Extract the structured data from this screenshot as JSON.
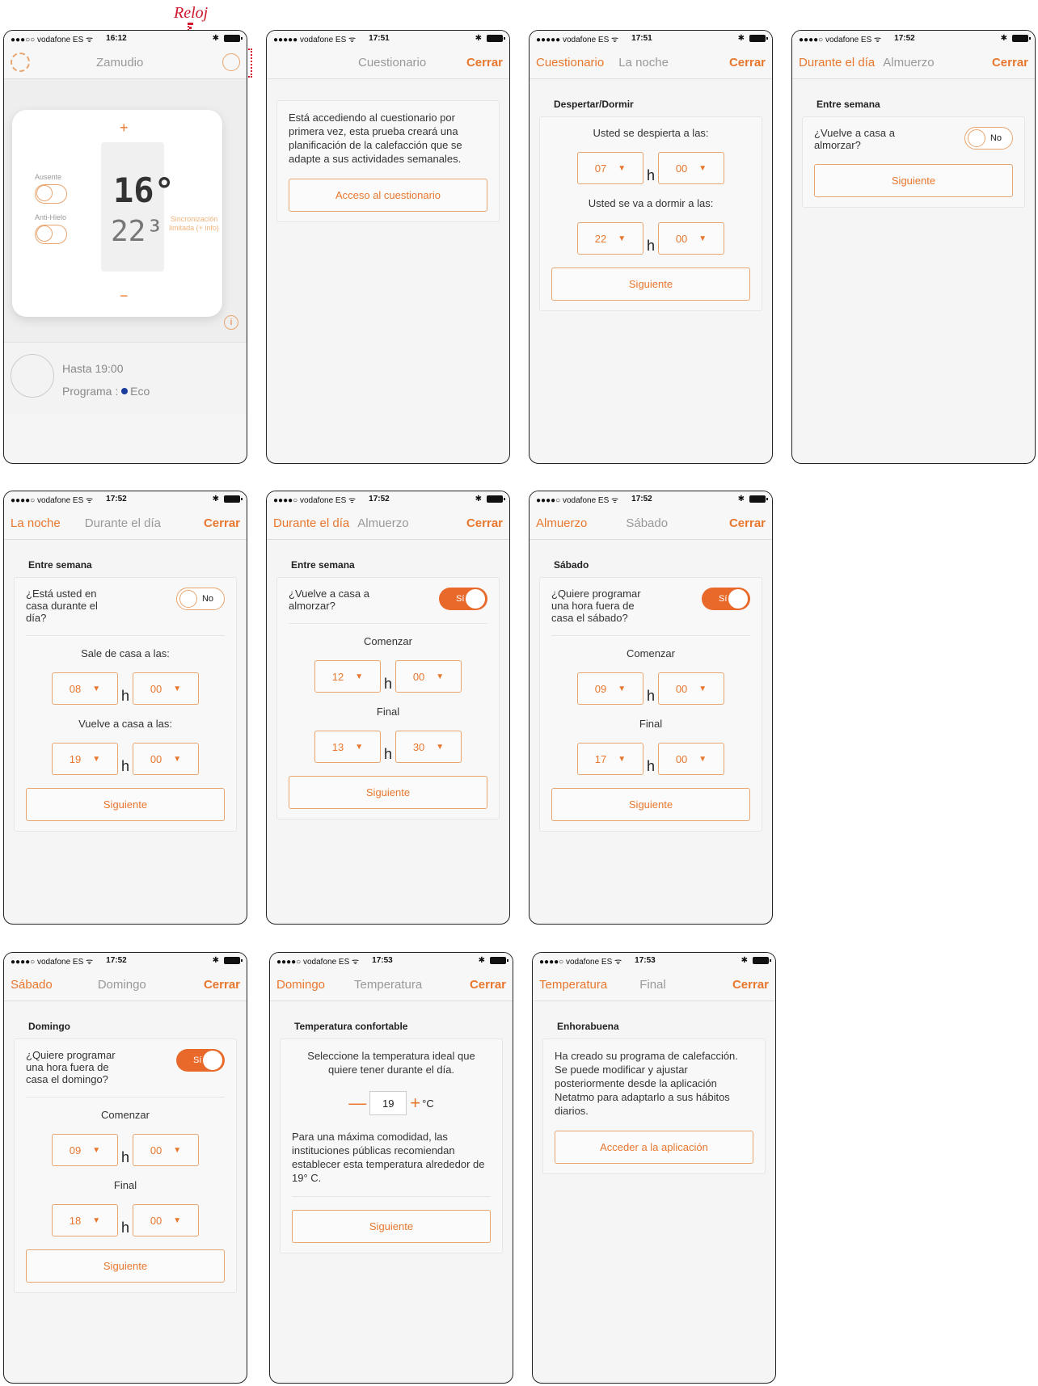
{
  "callout": {
    "label": "Reloj"
  },
  "screens": {
    "s1": {
      "status": {
        "carrier": "●●●○○ vodafone ES ᯤ",
        "time": "16:12"
      },
      "nav_title": "Zamudio",
      "thermostat": {
        "plus": "+",
        "minus": "−",
        "temp_current": "16°",
        "temp_setpoint": "22³",
        "absent_label": "Ausente",
        "antifreeze_label": "Anti-Hielo",
        "sync_text": "Sincronización limitada (+ info)",
        "info": "i"
      },
      "footer": {
        "until": "Hasta 19:00",
        "program_prefix": "Programa :",
        "program_value": "Eco"
      }
    },
    "s2": {
      "status": {
        "carrier": "●●●●● vodafone ES ᯤ",
        "time": "17:51"
      },
      "nav": {
        "title": "Cuestionario",
        "close": "Cerrar"
      },
      "card_text": "Está accediendo al cuestionario por primera vez, esta prueba creará una planificación de la calefacción que se adapte a sus actividades semanales.",
      "button": "Acceso al cuestionario"
    },
    "s3": {
      "status": {
        "carrier": "●●●●● vodafone ES ᯤ",
        "time": "17:51"
      },
      "nav": {
        "prev": "Cuestionario",
        "title": "La noche",
        "close": "Cerrar"
      },
      "section": "Despertar/Dormir",
      "wake_label": "Usted se despierta a las:",
      "wake": {
        "h": "07",
        "m": "00"
      },
      "sleep_label": "Usted se va a dormir a las:",
      "sleep": {
        "h": "22",
        "m": "00"
      },
      "h": "h",
      "button": "Siguiente"
    },
    "s4": {
      "status": {
        "carrier": "●●●●○ vodafone ES ᯤ",
        "time": "17:52"
      },
      "nav": {
        "prev": "Durante el día",
        "title": "Almuerzo",
        "close": "Cerrar"
      },
      "section": "Entre semana",
      "question": "¿Vuelve a casa a almorzar?",
      "toggle": "No",
      "button": "Siguiente"
    },
    "s5": {
      "status": {
        "carrier": "●●●●○ vodafone ES ᯤ",
        "time": "17:52"
      },
      "nav": {
        "prev": "La noche",
        "title": "Durante el día",
        "close": "Cerrar"
      },
      "section": "Entre semana",
      "question": "¿Está usted en casa durante el día?",
      "toggle": "No",
      "leave_label": "Sale de casa a las:",
      "leave": {
        "h": "08",
        "m": "00"
      },
      "return_label": "Vuelve a casa a las:",
      "return": {
        "h": "19",
        "m": "00"
      },
      "h": "h",
      "button": "Siguiente"
    },
    "s6": {
      "status": {
        "carrier": "●●●●○ vodafone ES ᯤ",
        "time": "17:52"
      },
      "nav": {
        "prev": "Durante el día",
        "title": "Almuerzo",
        "close": "Cerrar"
      },
      "section": "Entre semana",
      "question": "¿Vuelve a casa a almorzar?",
      "toggle": "Sí",
      "start_label": "Comenzar",
      "start": {
        "h": "12",
        "m": "00"
      },
      "end_label": "Final",
      "end": {
        "h": "13",
        "m": "30"
      },
      "h": "h",
      "button": "Siguiente"
    },
    "s7": {
      "status": {
        "carrier": "●●●●○ vodafone ES ᯤ",
        "time": "17:52"
      },
      "nav": {
        "prev": "Almuerzo",
        "title": "Sábado",
        "close": "Cerrar"
      },
      "section": "Sábado",
      "question": "¿Quiere programar una hora fuera de casa el sábado?",
      "toggle": "Sí",
      "start_label": "Comenzar",
      "start": {
        "h": "09",
        "m": "00"
      },
      "end_label": "Final",
      "end": {
        "h": "17",
        "m": "00"
      },
      "h": "h",
      "button": "Siguiente"
    },
    "s8": {
      "status": {
        "carrier": "●●●●○ vodafone ES ᯤ",
        "time": "17:52"
      },
      "nav": {
        "prev": "Sábado",
        "title": "Domingo",
        "close": "Cerrar"
      },
      "section": "Domingo",
      "question": "¿Quiere programar una hora fuera de casa el domingo?",
      "toggle": "Sí",
      "start_label": "Comenzar",
      "start": {
        "h": "09",
        "m": "00"
      },
      "end_label": "Final",
      "end": {
        "h": "18",
        "m": "00"
      },
      "h": "h",
      "button": "Siguiente"
    },
    "s9": {
      "status": {
        "carrier": "●●●●○ vodafone ES ᯤ",
        "time": "17:53"
      },
      "nav": {
        "prev": "Domingo",
        "title": "Temperatura",
        "close": "Cerrar"
      },
      "section": "Temperatura confortable",
      "intro": "Seleccione la temperatura ideal que quiere tener durante el día.",
      "temp_value": "19",
      "temp_unit": "°C",
      "note": "Para una máxima comodidad, las instituciones públicas recomiendan establecer esta temperatura alrededor de 19° C.",
      "button": "Siguiente"
    },
    "s10": {
      "status": {
        "carrier": "●●●●○ vodafone ES ᯤ",
        "time": "17:53"
      },
      "nav": {
        "prev": "Temperatura",
        "title": "Final",
        "close": "Cerrar"
      },
      "section": "Enhorabuena",
      "text": "Ha creado su programa de calefacción. Se puede modificar y ajustar posteriormente desde la aplicación Netatmo para adaptarlo a sus hábitos diarios.",
      "button": "Acceder a la aplicación"
    }
  },
  "colors": {
    "accent": "#e8772e",
    "toggle_on": "#e8692a",
    "callout": "#d0192e"
  }
}
